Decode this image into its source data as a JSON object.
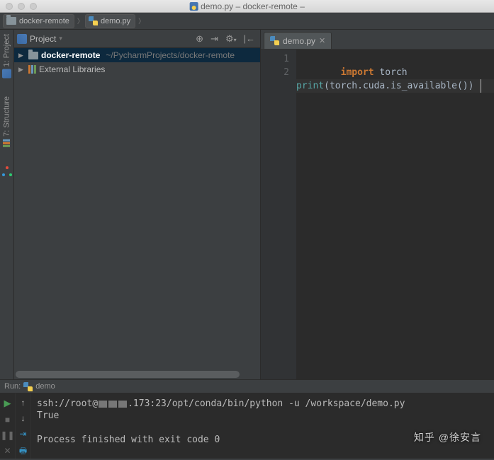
{
  "window": {
    "title": "demo.py – docker-remote –"
  },
  "breadcrumb": {
    "project": "docker-remote",
    "file": "demo.py"
  },
  "sidebar": {
    "project_tab": "1: Project",
    "structure_tab": "7: Structure"
  },
  "project_panel": {
    "title": "Project",
    "toolbar": {
      "target": "⊕",
      "collapse": "⇥",
      "gear": "⚙",
      "hide": "|←"
    },
    "tree": {
      "root_name": "docker-remote",
      "root_path": "~/PycharmProjects/docker-remote",
      "external": "External Libraries"
    }
  },
  "editor": {
    "tab_label": "demo.py",
    "gutter": [
      "1",
      "2"
    ],
    "code": {
      "l1": {
        "kw": "import",
        "id": "torch"
      },
      "l2": {
        "fn": "print",
        "open": "(",
        "a": "torch",
        "dot1": ".",
        "b": "cuda",
        "dot2": ".",
        "c": "is_available",
        "close": "())"
      }
    }
  },
  "run": {
    "title": "Run:",
    "config": "demo",
    "console": {
      "cmd_prefix": "ssh://root@",
      "cmd_suffix": ".173:23/opt/conda/bin/python -u /workspace/demo.py",
      "output": "True",
      "exit": "Process finished with exit code 0"
    }
  },
  "watermark": "知乎 @徐安言"
}
